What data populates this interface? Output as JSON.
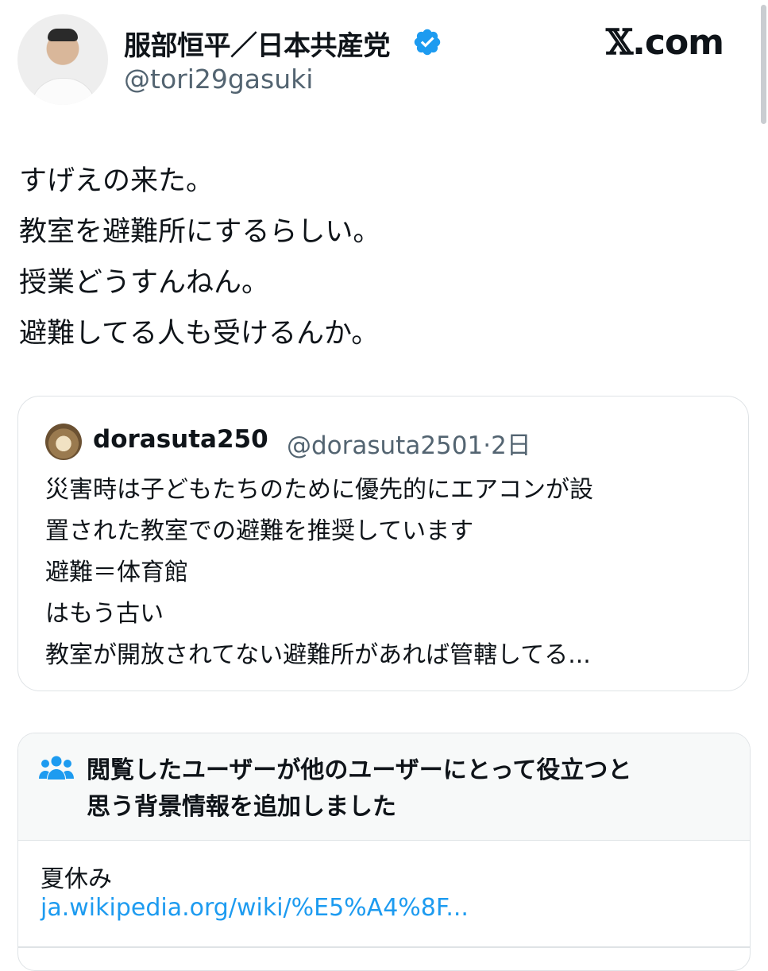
{
  "author": {
    "display_name": "服部恒平／日本共産党",
    "handle": "@tori29gasuki",
    "verified": true
  },
  "brand": {
    "logo_letter": "𝕏",
    "logo_text": ".com"
  },
  "tweet": {
    "lines": [
      "すげえの来た。",
      "教室を避難所にするらしい。",
      "授業どうすんねん。",
      "避難してる人も受けるんか。"
    ]
  },
  "quote": {
    "name": "dorasuta250",
    "handle_time": "@dorasuta2501·2日",
    "lines": [
      "災害時は子どもたちのために優先的にエアコンが設",
      "置された教室での避難を推奨しています",
      "避難＝体育館",
      "はもう古い",
      "教室が開放されてない避難所があれば管轄してる..."
    ]
  },
  "community_note": {
    "icon": "people-icon",
    "title_lines": [
      "閲覧したユーザーが他のユーザーにとって役立つと",
      "思う背景情報を追加しました"
    ],
    "body": "夏休み",
    "link": "ja.wikipedia.org/wiki/%E5%A4%8F..."
  },
  "colors": {
    "verified_blue": "#1d9bf0",
    "link_blue": "#1d9bf0",
    "secondary_text": "#536471",
    "border": "#dfe3e6"
  }
}
